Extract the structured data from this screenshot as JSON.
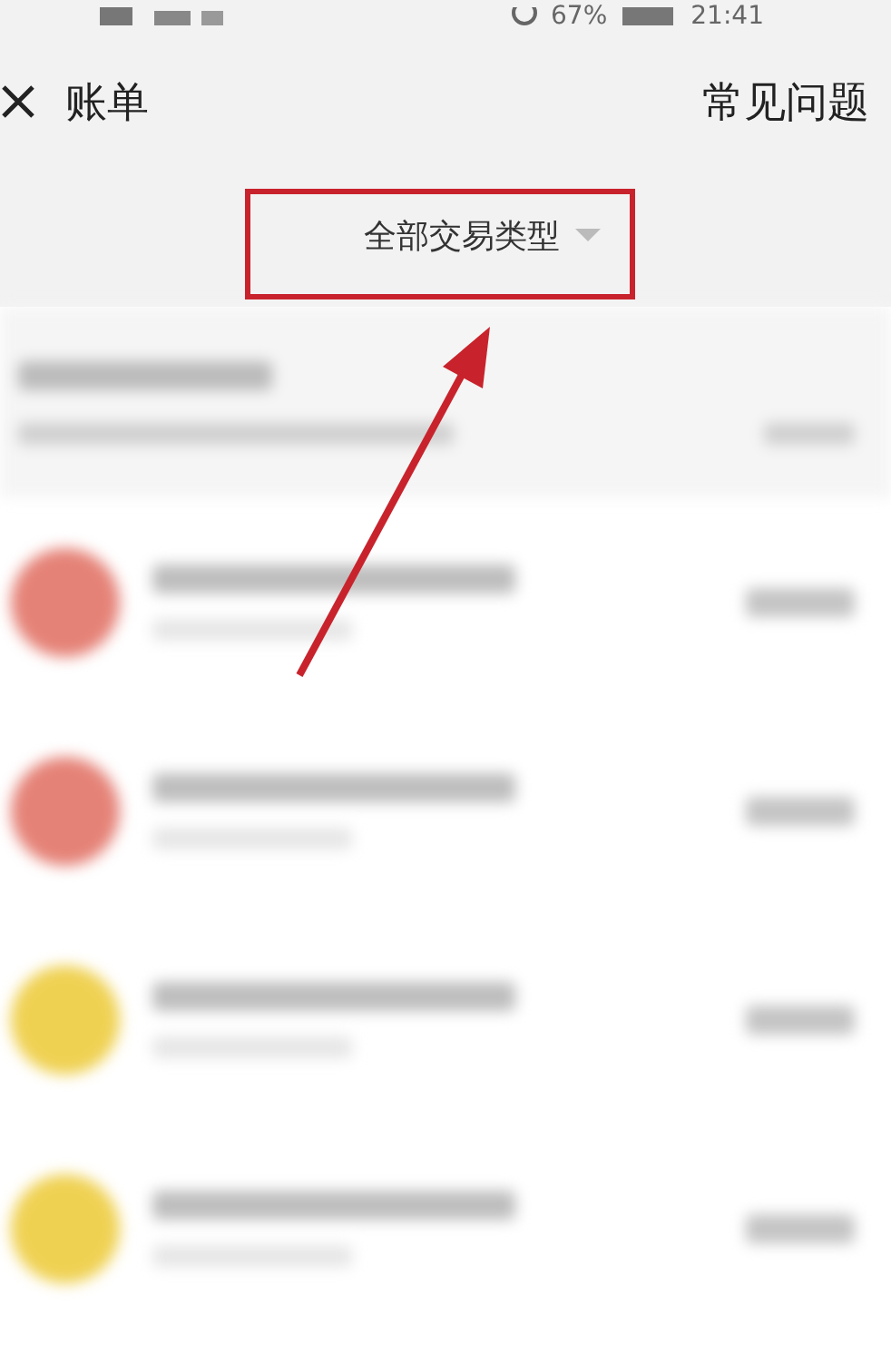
{
  "status_bar": {
    "battery": "67%",
    "time": "21:41"
  },
  "header": {
    "title": "账单",
    "help": "常见问题"
  },
  "filter": {
    "label": "全部交易类型"
  },
  "transactions": [
    {
      "color": "#e58277"
    },
    {
      "color": "#e58277"
    },
    {
      "color": "#efd152"
    },
    {
      "color": "#efd152"
    }
  ]
}
